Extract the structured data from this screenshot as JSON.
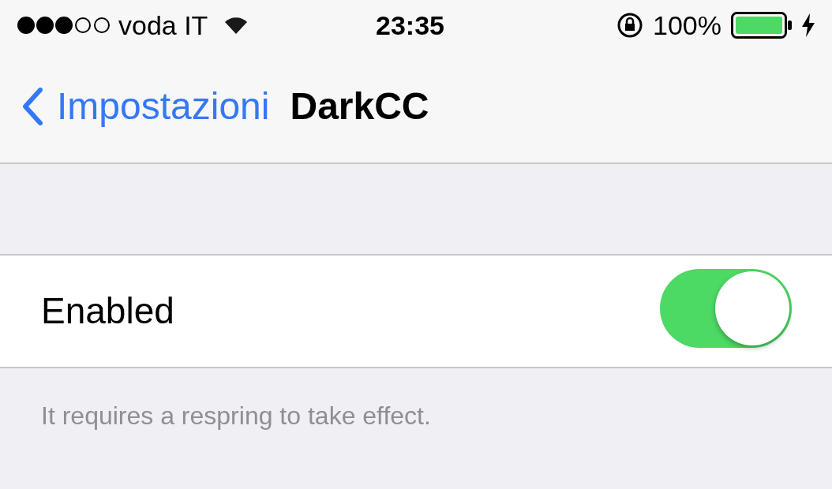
{
  "status_bar": {
    "carrier": "voda IT",
    "time": "23:35",
    "battery": "100%"
  },
  "nav_bar": {
    "back": "Impostazioni",
    "title": "DarkCC"
  },
  "settings": [
    {
      "kind": "switch",
      "label": "Enabled",
      "on": true
    }
  ],
  "footer": "It requires a respring to take effect."
}
